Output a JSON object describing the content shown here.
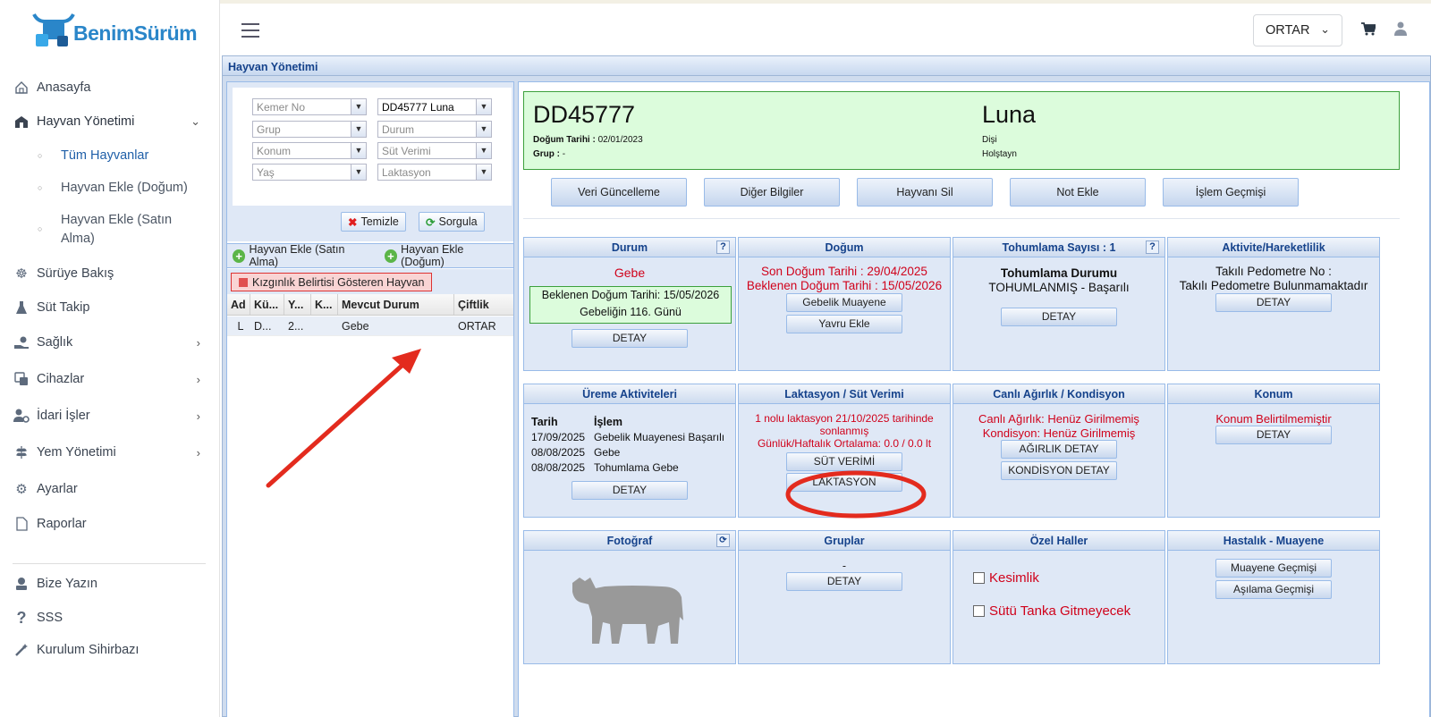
{
  "brand": {
    "name": "BenimSürüm"
  },
  "sidebar": {
    "items": [
      {
        "label": "Anasayfa"
      },
      {
        "label": "Hayvan Yönetimi"
      },
      {
        "label": "Sürüye Bakış"
      },
      {
        "label": "Süt Takip"
      },
      {
        "label": "Sağlık"
      },
      {
        "label": "Cihazlar"
      },
      {
        "label": "İdari İşler"
      },
      {
        "label": "Yem Yönetimi"
      },
      {
        "label": "Ayarlar"
      },
      {
        "label": "Raporlar"
      },
      {
        "label": "Bize Yazın"
      },
      {
        "label": "SSS"
      },
      {
        "label": "Kurulum Sihirbazı"
      }
    ],
    "sub": [
      {
        "label": "Tüm Hayvanlar"
      },
      {
        "label": "Hayvan Ekle (Doğum)"
      },
      {
        "label": "Hayvan Ekle (Satın Alma)"
      }
    ]
  },
  "header": {
    "farm": "ORTAR"
  },
  "panel": {
    "title": "Hayvan Yönetimi"
  },
  "filters": {
    "kemer": "Kemer No",
    "search_value": "DD45777 Luna",
    "grup": "Grup",
    "durum": "Durum",
    "konum": "Konum",
    "sut": "Süt Verimi",
    "yas": "Yaş",
    "laktasyon": "Laktasyon",
    "clear": "Temizle",
    "query": "Sorgula"
  },
  "add": {
    "purchase": "Hayvan Ekle (Satın Alma)",
    "birth": "Hayvan Ekle (Doğum)"
  },
  "estrus": "Kızgınlık Belirtisi Gösteren Hayvan",
  "grid": {
    "headers": [
      "Ad",
      "Kü...",
      "Y...",
      "K...",
      "Mevcut Durum",
      "Çiftlik"
    ],
    "rows": [
      [
        "L",
        "D...",
        "2...",
        "",
        "Gebe",
        "ORTAR"
      ]
    ]
  },
  "animal": {
    "id": "DD45777",
    "name": "Luna",
    "birth_label": "Doğum Tarihi :",
    "birth_value": "02/01/2023",
    "group_label": "Grup :",
    "group_value": "-",
    "sex": "Dişi",
    "breed": "Holştayn"
  },
  "actions": {
    "update": "Veri Güncelleme",
    "other": "Diğer Bilgiler",
    "delete": "Hayvanı Sil",
    "note": "Not Ekle",
    "history": "İşlem Geçmişi"
  },
  "cards": {
    "durum": {
      "title": "Durum",
      "status": "Gebe",
      "expected": "Beklenen Doğum Tarihi: 15/05/2026",
      "day": "Gebeliğin 116. Günü",
      "detail": "DETAY"
    },
    "dogum": {
      "title": "Doğum",
      "last": "Son Doğum Tarihi : 29/04/2025",
      "expected": "Beklenen Doğum Tarihi : 15/05/2026",
      "exam": "Gebelik Muayene",
      "calf": "Yavru Ekle"
    },
    "tohum": {
      "title": "Tohumlama Sayısı : 1",
      "state_label": "Tohumlama Durumu",
      "state": "TOHUMLANMIŞ - Başarılı",
      "detail": "DETAY"
    },
    "aktivite": {
      "title": "Aktivite/Hareketlilik",
      "ped": "Takılı Pedometre No :",
      "none": "Takılı Pedometre Bulunmamaktadır",
      "detail": "DETAY"
    },
    "ureme": {
      "title": "Üreme Aktiviteleri",
      "h1": "Tarih",
      "h2": "İşlem",
      "rows": [
        [
          "17/09/2025",
          "Gebelik Muayenesi Başarılı"
        ],
        [
          "08/08/2025",
          "Gebe"
        ],
        [
          "08/08/2025",
          "Tohumlama Gebe"
        ]
      ],
      "detail": "DETAY"
    },
    "laktasyon": {
      "title": "Laktasyon / Süt Verimi",
      "l1": "1 nolu laktasyon 21/10/2025 tarihinde",
      "l2": "sonlanmış",
      "l3": "Günlük/Haftalık Ortalama: 0.0 / 0.0 lt",
      "milk": "SÜT VERİMİ",
      "lact": "LAKTASYON"
    },
    "agirlik": {
      "title": "Canlı Ağırlık / Kondisyon",
      "w": "Canlı Ağırlık: Henüz Girilmemiş",
      "k": "Kondisyon: Henüz Girilmemiş",
      "wbtn": "AĞIRLIK DETAY",
      "kbtn": "KONDİSYON DETAY"
    },
    "konum": {
      "title": "Konum",
      "none": "Konum Belirtilmemiştir",
      "detail": "DETAY"
    },
    "foto": {
      "title": "Fotoğraf"
    },
    "gruplar": {
      "title": "Gruplar",
      "value": "-",
      "detail": "DETAY"
    },
    "ozel": {
      "title": "Özel Haller",
      "c1": "Kesimlik",
      "c2": "Sütü Tanka Gitmeyecek"
    },
    "hastalik": {
      "title": "Hastalık - Muayene",
      "b1": "Muayene Geçmişi",
      "b2": "Aşılama Geçmişi"
    }
  },
  "colors": {
    "accent_red": "#d0021b",
    "panel_blue": "#dfe8f6",
    "header_blue": "#15428b",
    "annotation_red": "#e32b1e"
  }
}
